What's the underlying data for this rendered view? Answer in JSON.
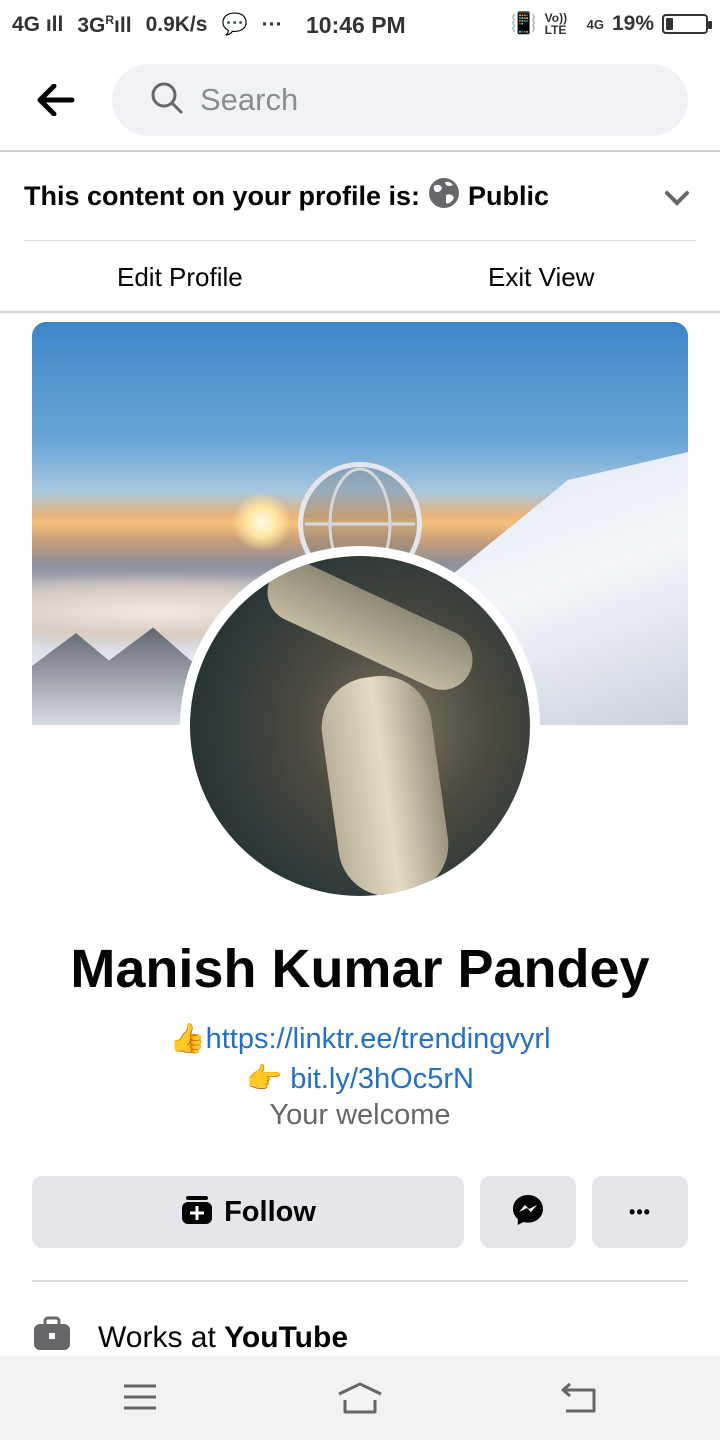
{
  "status_bar": {
    "network1": "4G",
    "network2": "3G",
    "roaming": "R",
    "speed": "0.9K/s",
    "dots": "···",
    "time": "10:46 PM",
    "volte": "Vo)) LTE",
    "lte2": "4G",
    "battery": "19%",
    "battery_level": 0.19
  },
  "search": {
    "placeholder": "Search"
  },
  "visibility": {
    "label": "This content on your profile is:",
    "value": "Public"
  },
  "tabs": {
    "edit": "Edit Profile",
    "exit": "Exit View"
  },
  "profile": {
    "name": "Manish Kumar Pandey",
    "bio_line1_emoji": "👍",
    "bio_line1_link": "https://linktr.ee/trendingvyrl",
    "bio_line2_emoji": "👉",
    "bio_line2_link": "bit.ly/3hOc5rN",
    "bio_line3": "Your welcome"
  },
  "actions": {
    "follow": "Follow",
    "messenger": "messenger-icon",
    "more": "•••"
  },
  "about": {
    "works_prefix": "Works at ",
    "employer": "YouTube"
  },
  "colors": {
    "link": "#2370c8",
    "button_bg": "#e4e6eb",
    "search_bg": "#f0f2f5"
  }
}
